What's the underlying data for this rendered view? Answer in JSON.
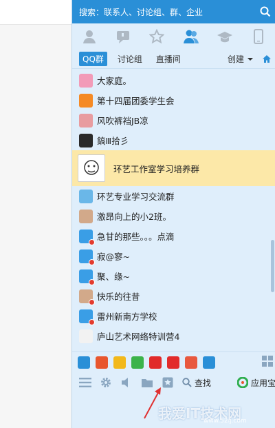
{
  "search": {
    "placeholder": "搜索：联系人、讨论组、群、企业"
  },
  "tabs": [
    {
      "icon": "contact-icon"
    },
    {
      "icon": "chat-icon"
    },
    {
      "icon": "star-icon"
    },
    {
      "icon": "group-icon",
      "active": true
    },
    {
      "icon": "hat-icon"
    },
    {
      "icon": "phone-icon"
    }
  ],
  "subtabs": {
    "qq_group": "QQ群",
    "discussion": "讨论组",
    "live": "直播间",
    "create": "创建"
  },
  "groups": [
    {
      "name": "大家庭。",
      "avatar_color": "#f29bb8"
    },
    {
      "name": "第十四届团委学生会",
      "avatar_color": "#f58a25"
    },
    {
      "name": "风吹裤裆JB凉",
      "avatar_color": "#e89ca0"
    },
    {
      "name": "鎬Ⅲ拾彡",
      "avatar_color": "#2a2a2a"
    },
    {
      "name": "环艺工作室学习培养群",
      "avatar_color": "#ffffff",
      "selected": true
    },
    {
      "name": "环艺专业学习交流群",
      "avatar_color": "#6ab7e8"
    },
    {
      "name": "激昂向上的小2班。",
      "avatar_color": "#d2a98a"
    },
    {
      "name": "急甘的那些。。。点滴",
      "avatar_color": "#3a9ee6",
      "badge": true
    },
    {
      "name": "寂@寥~",
      "avatar_color": "#3a9ee6",
      "badge": true
    },
    {
      "name": "聚、缘~",
      "avatar_color": "#3a9ee6",
      "badge": true
    },
    {
      "name": "快乐的往昔",
      "avatar_color": "#d2a98a",
      "badge": true
    },
    {
      "name": "雷州新南方学校",
      "avatar_color": "#3a9ee6",
      "badge": true
    },
    {
      "name": "庐山艺术网络特训营4",
      "avatar_color": "#f2f2f2"
    }
  ],
  "apps": [
    "#2a8fd7",
    "#e8562e",
    "#f2b81a",
    "#3bb34a",
    "#e12a2a",
    "#e22b2b",
    "#e8583e",
    "#2a8fd7"
  ],
  "bottom": {
    "find": "查找",
    "app_store": "应用宝"
  },
  "watermark": {
    "text": "我爱IT技术网",
    "url": "www.52ij.com"
  },
  "colors": {
    "accent": "#2a8fd7",
    "panel_bg": "#dfeefb",
    "selected_bg": "#fce8a8"
  }
}
